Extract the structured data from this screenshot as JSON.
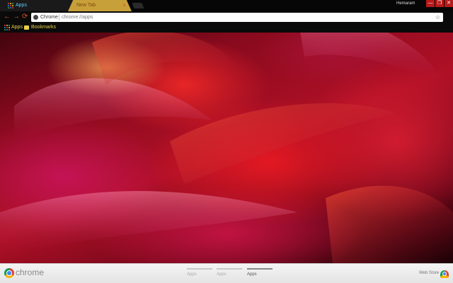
{
  "browser": {
    "tabs": [
      {
        "title": "Apps",
        "close": "×"
      },
      {
        "title": "New Tab",
        "close": "×"
      }
    ],
    "profile_name": "Hemaram",
    "window_controls": [
      "—",
      "❐",
      "✕"
    ],
    "nav": {
      "back": "←",
      "forward": "→",
      "reload": "⟳"
    },
    "omnibox": {
      "chip": "Chrome",
      "url": "chrome://apps",
      "star": "☆"
    },
    "bookmarks_bar": [
      {
        "label": "Apps",
        "icon": "apps-grid-icon"
      },
      {
        "label": "Bookmarks",
        "icon": "folder-icon"
      }
    ]
  },
  "wallpaper": {
    "subject": "rose-wallpaper",
    "colors": [
      "#b01026",
      "#e0522a",
      "#c81a5a"
    ]
  },
  "bottom_bar": {
    "brand": "chrome",
    "page_indicators": [
      {
        "label": "Apps",
        "active": false
      },
      {
        "label": "Apps",
        "active": false
      },
      {
        "label": "Apps",
        "active": true
      }
    ],
    "web_store_label": "Web Store"
  },
  "colors": {
    "accent_tab": "#c8a03a",
    "nav_icon": "#e0522a",
    "bookmark_text": "#e6d04a",
    "tab_text": "#5ec8ff"
  }
}
